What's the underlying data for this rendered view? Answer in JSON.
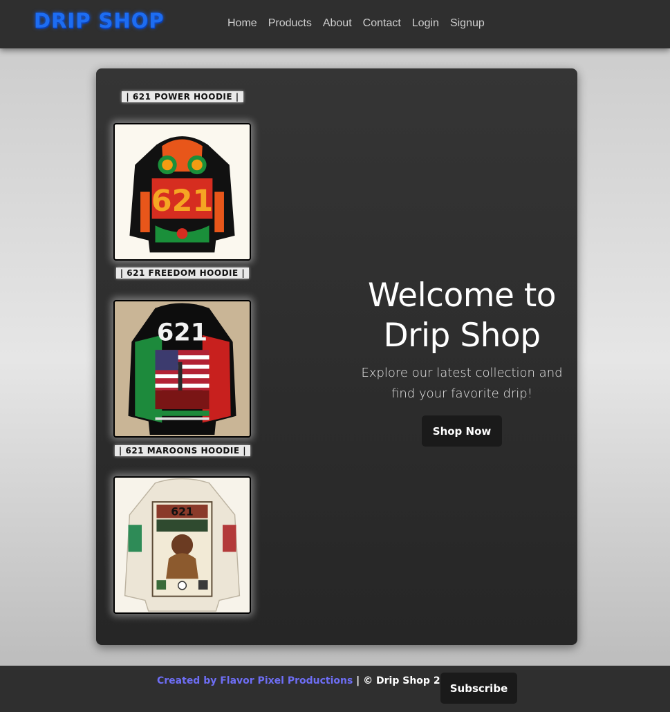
{
  "header": {
    "logo": "DRIP SHOP",
    "nav": [
      "Home",
      "Products",
      "About",
      "Contact",
      "Login",
      "Signup"
    ]
  },
  "products": [
    {
      "title": "| 621 POWER HOODIE |"
    },
    {
      "title": "| 621 FREEDOM HOODIE |"
    },
    {
      "title": "| 621 MAROONS HOODIE |"
    }
  ],
  "hero": {
    "title_line1": "Welcome to",
    "title_line2": "Drip Shop",
    "subtitle_line1": "Explore our latest collection and",
    "subtitle_line2": "find your favorite drip!",
    "cta": "Shop Now"
  },
  "footer": {
    "credit_link": "Created by Flavor Pixel Productions",
    "copyright": " | © Drip Shop 2024",
    "subscribe": "Subscribe"
  },
  "colors": {
    "accent_blue": "#1d6df2",
    "footer_link": "#6e6ef5",
    "panel": "#2e2e2e",
    "header": "#2f2f2f"
  }
}
